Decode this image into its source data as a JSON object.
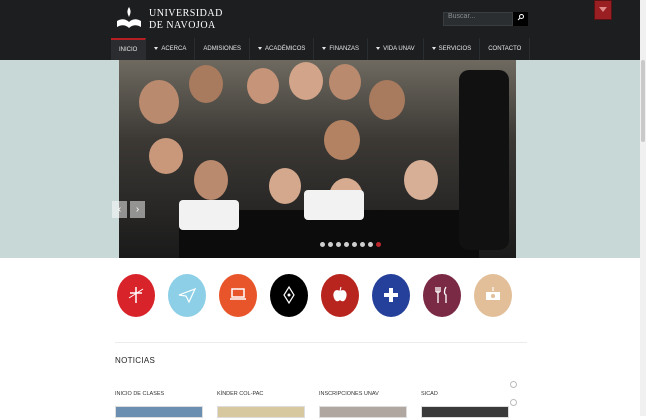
{
  "header": {
    "logo_line1": "UNIVERSIDAD",
    "logo_line2": "DE NAVOJOA",
    "search_placeholder": "Buscar...",
    "search_icon": "search-icon"
  },
  "nav": {
    "items": [
      {
        "label": "INICIO",
        "active": true,
        "caret": false
      },
      {
        "label": "ACERCA",
        "active": false,
        "caret": true
      },
      {
        "label": "ADMISIONES",
        "active": false,
        "caret": false
      },
      {
        "label": "ACADÉMICOS",
        "active": false,
        "caret": true
      },
      {
        "label": "FINANZAS",
        "active": false,
        "caret": true
      },
      {
        "label": "VIDA UNAV",
        "active": false,
        "caret": true
      },
      {
        "label": "SERVICIOS",
        "active": false,
        "caret": true
      },
      {
        "label": "CONTACTO",
        "active": false,
        "caret": false
      }
    ]
  },
  "slider": {
    "prev_label": "‹",
    "next_label": "›",
    "slide_count": 8,
    "active_slide": 7
  },
  "quick_links": [
    {
      "icon": "cross-icon",
      "color": "#d8232a"
    },
    {
      "icon": "paper-plane-icon",
      "color": "#8ccfe6"
    },
    {
      "icon": "laptop-icon",
      "color": "#e8552a"
    },
    {
      "icon": "pen-nib-icon",
      "color": "#000000"
    },
    {
      "icon": "apple-icon",
      "color": "#b8251f"
    },
    {
      "icon": "medical-cross-icon",
      "color": "#25409a"
    },
    {
      "icon": "cutlery-icon",
      "color": "#7a2a45"
    },
    {
      "icon": "money-icon",
      "color": "#e2bf98"
    }
  ],
  "news": {
    "title": "NOTICIAS",
    "items": [
      {
        "label": "INICIO DE CLASES"
      },
      {
        "label": "KÍNDER COL-PAC"
      },
      {
        "label": "INSCRIPCIONES UNAV"
      },
      {
        "label": "SICAD"
      }
    ]
  },
  "colors": {
    "header_bg": "#1c1e20",
    "accent": "#c0272d",
    "hero_bg": "#c7d8d6"
  }
}
